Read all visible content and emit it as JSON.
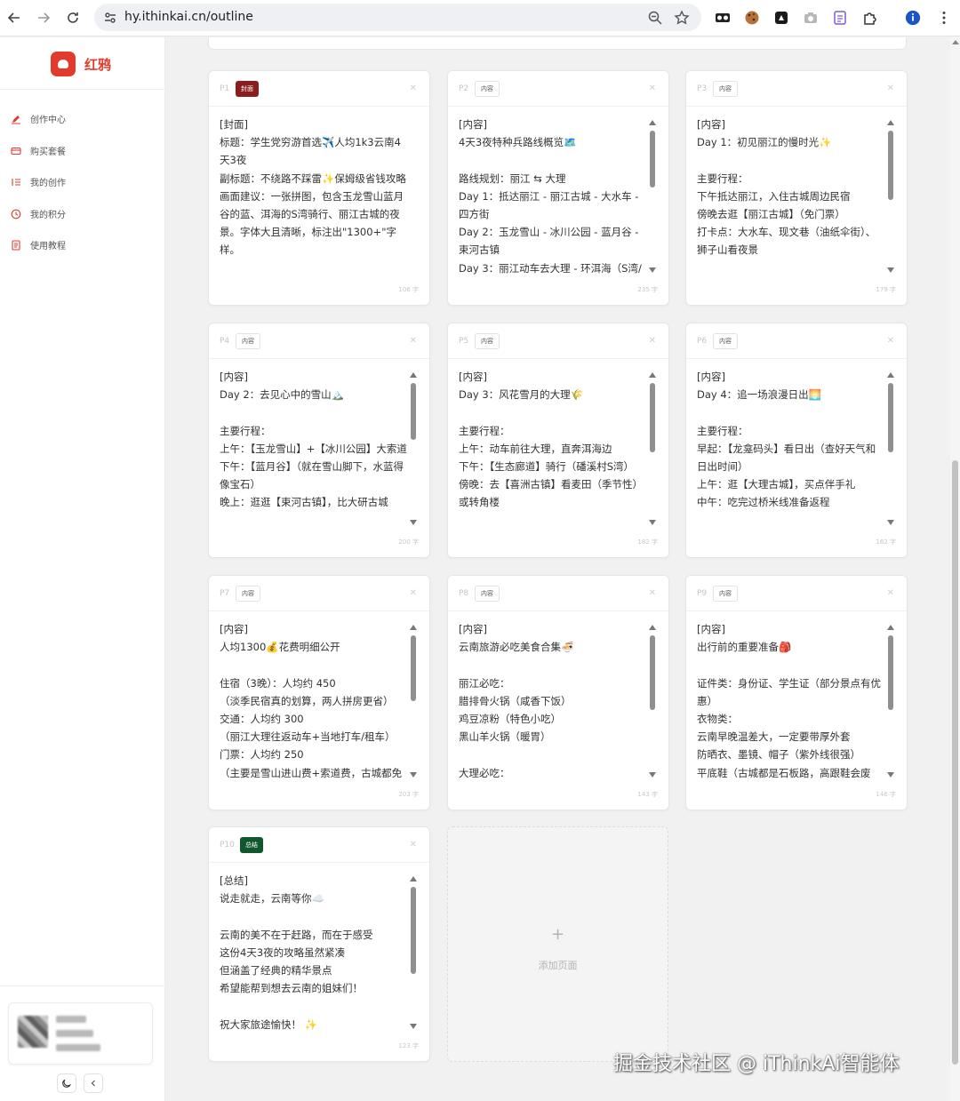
{
  "browser": {
    "url": "hy.ithinkai.cn/outline"
  },
  "sidebar": {
    "brand": "红鸦",
    "items": [
      {
        "label": "创作中心"
      },
      {
        "label": "购买套餐"
      },
      {
        "label": "我的创作"
      },
      {
        "label": "我的积分"
      },
      {
        "label": "使用教程"
      }
    ]
  },
  "cards": [
    {
      "num": "P1",
      "badge": "封面",
      "body": "[封面]\n标题：学生党穷游首选✈️人均1k3云南4天3夜\n副标题：不绕路不踩雷✨保姆级省钱攻略\n画面建议：一张拼图，包含玉龙雪山蓝月谷的蓝、洱海的S湾骑行、丽江古城的夜景。字体大且清晰，标注出\"1300+\"字样。",
      "count": "106 字"
    },
    {
      "num": "P2",
      "badge": "内容",
      "body": "[内容]\n4天3夜特种兵路线概览🗺️\n\n路线规划：丽江 ⇆ 大理\nDay 1：抵达丽江 - 丽江古城 - 大水车 - 四方街\nDay 2：玉龙雪山 - 冰川公园 - 蓝月谷 - 束河古镇\nDay 3：丽江动车去大理 - 环洱海（S湾/",
      "count": "235 字"
    },
    {
      "num": "P3",
      "badge": "内容",
      "body": "[内容]\nDay 1：初见丽江的慢时光✨\n\n主要行程：\n下午抵达丽江，入住古城周边民宿\n傍晚去逛【丽江古城】（免门票）\n打卡点：大水车、现文巷（油纸伞街）、狮子山看夜景",
      "count": "179 字"
    },
    {
      "num": "P4",
      "badge": "内容",
      "body": "[内容]\nDay 2：去见心中的雪山🏔️\n\n主要行程：\n上午：【玉龙雪山】+【冰川公园】大索道\n下午：【蓝月谷】（就在雪山脚下，水蓝得像宝石）\n晚上：逛逛【束河古镇】，比大研古城",
      "count": "200 字"
    },
    {
      "num": "P5",
      "badge": "内容",
      "body": "[内容]\nDay 3：风花雪月的大理🌾\n\n主要行程：\n上午：动车前往大理，直奔洱海边\n下午：【生态廊道】骑行（磻溪村S湾）\n傍晚：去【喜洲古镇】看麦田（季节性）或转角楼",
      "count": "182 字"
    },
    {
      "num": "P6",
      "badge": "内容",
      "body": "[内容]\nDay 4：追一场浪漫日出🌅\n\n主要行程：\n早起：【龙龛码头】看日出（查好天气和日出时间）\n上午：逛【大理古城】，买点伴手礼\n中午：吃完过桥米线准备返程",
      "count": "162 字"
    },
    {
      "num": "P7",
      "badge": "内容",
      "body": "[内容]\n人均1300💰花费明细公开\n\n住宿（3晚）：人均约 450\n（淡季民宿真的划算，两人拼房更省）\n交通：人均约 300\n（丽江大理往返动车+当地打车/租车）\n门票：人均约 250\n（主要是雪山进山费+索道费，古城都免",
      "count": "203 字"
    },
    {
      "num": "P8",
      "badge": "内容",
      "body": "[内容]\n云南旅游必吃美食合集🍜\n\n丽江必吃：\n腊排骨火锅（咸香下饭）\n鸡豆凉粉（特色小吃）\n黑山羊火锅（暖胃）\n\n大理必吃：",
      "count": "143 字"
    },
    {
      "num": "P9",
      "badge": "内容",
      "body": "[内容]\n出行前的重要准备🎒\n\n证件类：身份证、学生证（部分景点有优惠）\n衣物类：\n云南早晚温差大，一定要带厚外套\n防晒衣、墨镜、帽子（紫外线很强）\n平底鞋（古城都是石板路，高跟鞋会废",
      "count": "146 字"
    },
    {
      "num": "P10",
      "badge": "总结",
      "body": "[总结]\n说走就走，云南等你☁️\n\n云南的美不在于赶路，而在于感受\n这份4天3夜的攻略虽然紧凑\n但涵盖了经典的精华景点\n希望能帮到想去云南的姐妹们！\n\n祝大家旅途愉快！ ✨",
      "count": "123 字"
    }
  ],
  "add_page": {
    "plus": "+",
    "label": "添加页面"
  },
  "watermark": "掘金技术社区 @ iThinkAi智能体",
  "colors": {
    "brand": "#e23b2e",
    "cover_badge": "#8c1d1d",
    "summary_badge": "#10572e"
  }
}
